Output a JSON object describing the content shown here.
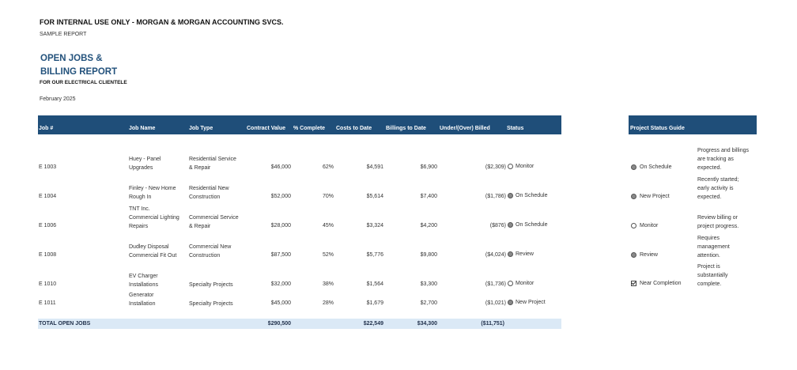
{
  "header": {
    "banner": "FOR INTERNAL USE ONLY - MORGAN & MORGAN ACCOUNTING SVCS.",
    "sample": "SAMPLE REPORT",
    "title_line1": "OPEN JOBS &",
    "title_line2": "BILLING REPORT",
    "subtitle": "FOR OUR ELECTRICAL CLIENTELE",
    "date": "February 2025"
  },
  "table": {
    "columns": [
      "Job #",
      "Job Name",
      "Job Type",
      "Contract Value",
      "% Complete",
      "Costs to Date",
      "Billings to Date",
      "Under/(Over) Billed",
      "Status"
    ],
    "rows": [
      {
        "job": "E 1003",
        "name1": "Huey - Panel",
        "name2": "Upgrades",
        "type1": "Residential Service",
        "type2": "& Repair",
        "contract": "$46,000",
        "pct": "62%",
        "costs": "$4,591",
        "billings": "$6,900",
        "under": "($2,309)",
        "status": "Monitor",
        "status_icon": "white"
      },
      {
        "job": "E 1004",
        "name1": "Finley - New Home",
        "name2": "Rough In",
        "type1": "Residential New",
        "type2": "Construction",
        "contract": "$52,000",
        "pct": "70%",
        "costs": "$5,614",
        "billings": "$7,400",
        "under": "($1,786)",
        "status": "On Schedule",
        "status_icon": "grey"
      },
      {
        "job": "E 1006",
        "name1": "TNT Inc.",
        "name2": "Commercial Lighting",
        "name3": "Repairs",
        "type1": "Commercial Service",
        "type2": "& Repair",
        "contract": "$28,000",
        "pct": "45%",
        "costs": "$3,324",
        "billings": "$4,200",
        "under": "($876)",
        "status": "On Schedule",
        "status_icon": "grey"
      },
      {
        "job": "E 1008",
        "name1": "Dudley Disposal",
        "name2": "Commercial Fit Out",
        "type1": "Commercial New",
        "type2": "Construction",
        "contract": "$87,500",
        "pct": "52%",
        "costs": "$5,776",
        "billings": "$9,800",
        "under": "($4,024)",
        "status": "Review",
        "status_icon": "grey"
      },
      {
        "job": "E 1010",
        "name1": "EV Charger",
        "name2": "Installations",
        "type1": "Specialty Projects",
        "type2": "",
        "contract": "$32,000",
        "pct": "38%",
        "costs": "$1,564",
        "billings": "$3,300",
        "under": "($1,736)",
        "status": "Monitor",
        "status_icon": "white"
      },
      {
        "job": "E 1011",
        "name1": "Generator",
        "name2": "Installation",
        "type1": "Specialty Projects",
        "type2": "",
        "contract": "$45,000",
        "pct": "28%",
        "costs": "$1,679",
        "billings": "$2,700",
        "under": "($1,021)",
        "status": "New Project",
        "status_icon": "grey"
      }
    ],
    "total": {
      "label": "TOTAL OPEN JOBS",
      "contract": "$290,500",
      "costs": "$22,549",
      "billings": "$34,300",
      "under": "($11,751)"
    }
  },
  "guide": {
    "header": "Project Status Guide",
    "items": [
      {
        "label": "On Schedule",
        "desc1": "Progress and billings",
        "desc2": "are tracking as",
        "desc3": "expected.",
        "icon": "grey"
      },
      {
        "label": "New Project",
        "desc1": "Recently started;",
        "desc2": "early activity is",
        "desc3": "expected.",
        "icon": "grey"
      },
      {
        "label": "Monitor",
        "desc1": "Review billing or",
        "desc2": "project progress.",
        "desc3": "",
        "icon": "white"
      },
      {
        "label": "Review",
        "desc1": "Requires",
        "desc2": "management",
        "desc3": "attention.",
        "icon": "grey"
      },
      {
        "label": "Near Completion",
        "desc1": "Project is",
        "desc2": "substantially",
        "desc3": "complete.",
        "icon": "check"
      }
    ]
  }
}
